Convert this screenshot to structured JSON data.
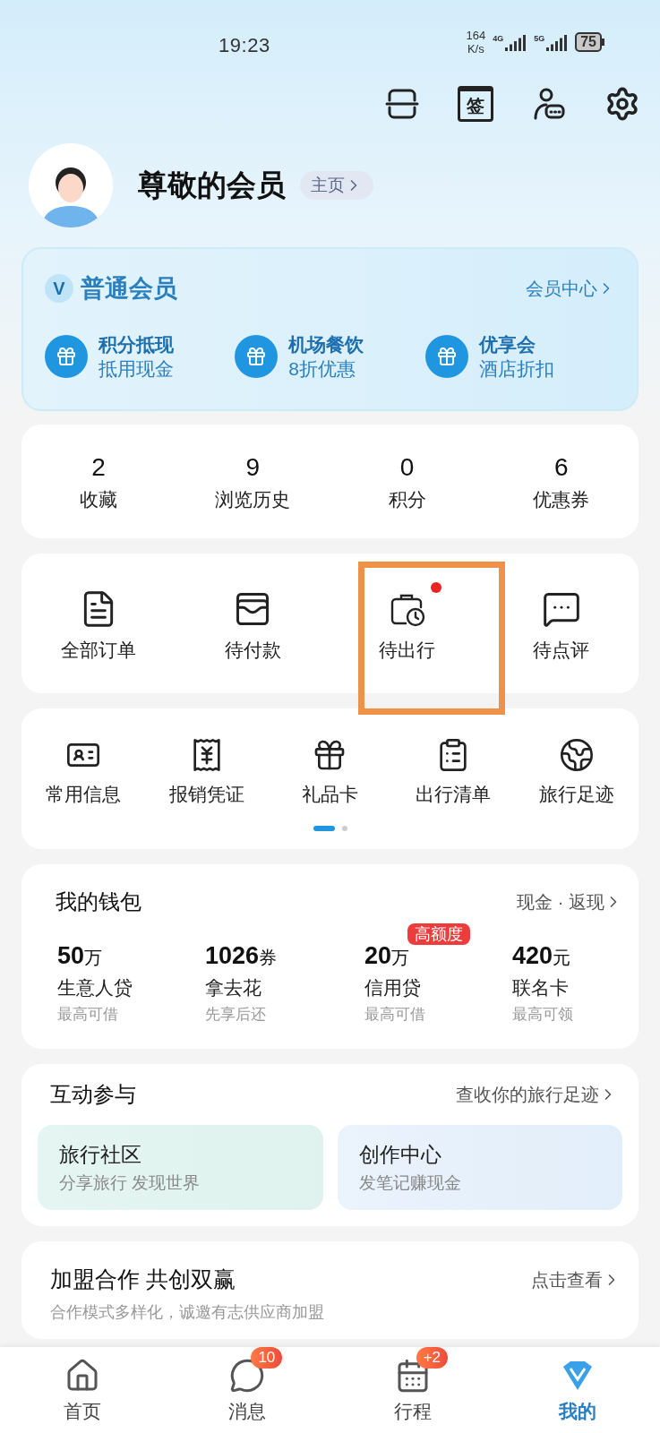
{
  "status_bar": {
    "time": "19:23",
    "net_speed": [
      "164",
      "K/s"
    ],
    "networks": [
      "4G",
      "5G"
    ],
    "battery": "75"
  },
  "top_actions": [
    {
      "kind": "scan"
    },
    {
      "kind": "sign",
      "glyph": "签"
    },
    {
      "kind": "service"
    },
    {
      "kind": "settings"
    }
  ],
  "profile": {
    "name": "尊敬的会员",
    "home_link": "主页"
  },
  "membership": {
    "badge": "V",
    "level": "普通会员",
    "center_link": "会员中心",
    "perks": [
      {
        "title": "积分抵现",
        "subtitle": "抵用现金"
      },
      {
        "title": "机场餐饮",
        "subtitle": "8折优惠"
      },
      {
        "title": "优享会",
        "subtitle": "酒店折扣"
      }
    ]
  },
  "stats": [
    {
      "value": "2",
      "label": "收藏"
    },
    {
      "value": "9",
      "label": "浏览历史"
    },
    {
      "value": "0",
      "label": "积分"
    },
    {
      "value": "6",
      "label": "优惠券"
    }
  ],
  "orders": [
    {
      "kind": "all",
      "label": "全部订单",
      "dot": false,
      "highlighted": false
    },
    {
      "kind": "pay",
      "label": "待付款",
      "dot": false,
      "highlighted": false
    },
    {
      "kind": "travel",
      "label": "待出行",
      "dot": true,
      "highlighted": true
    },
    {
      "kind": "review",
      "label": "待点评",
      "dot": false,
      "highlighted": false
    }
  ],
  "tools": [
    {
      "kind": "id",
      "label": "常用信息"
    },
    {
      "kind": "receipt",
      "label": "报销凭证"
    },
    {
      "kind": "gift",
      "label": "礼品卡"
    },
    {
      "kind": "list",
      "label": "出行清单"
    },
    {
      "kind": "globe",
      "label": "旅行足迹"
    }
  ],
  "tools_pager": [
    {
      "selected": true
    },
    {
      "selected": false
    }
  ],
  "wallet": {
    "title": "我的钱包",
    "link": "现金 · 返现",
    "items": [
      {
        "amount": "50",
        "unit": "万",
        "label": "生意人贷",
        "note": "最高可借"
      },
      {
        "amount": "1026",
        "unit": "券",
        "label": "拿去花",
        "note": "先享后还"
      },
      {
        "amount": "20",
        "unit": "万",
        "label": "信用贷",
        "note": "最高可借",
        "tag": "高额度"
      },
      {
        "amount": "420",
        "unit": "元",
        "label": "联名卡",
        "note": "最高可领"
      }
    ]
  },
  "interaction": {
    "title": "互动参与",
    "link": "查收你的旅行足迹",
    "cards": [
      {
        "kind": "community",
        "title": "旅行社区",
        "subtitle": "分享旅行 发现世界"
      },
      {
        "kind": "creator",
        "title": "创作中心",
        "subtitle": "发笔记赚现金"
      }
    ]
  },
  "franchise": {
    "title": "加盟合作 共创双赢",
    "link": "点击查看",
    "subtitle": "合作模式多样化，诚邀有志供应商加盟"
  },
  "tabs": [
    {
      "kind": "home",
      "label": "首页",
      "selected": false
    },
    {
      "kind": "message",
      "label": "消息",
      "badge": "10",
      "selected": false
    },
    {
      "kind": "trip",
      "label": "行程",
      "badge": "+2",
      "selected": false
    },
    {
      "kind": "mine",
      "label": "我的",
      "selected": true
    }
  ]
}
